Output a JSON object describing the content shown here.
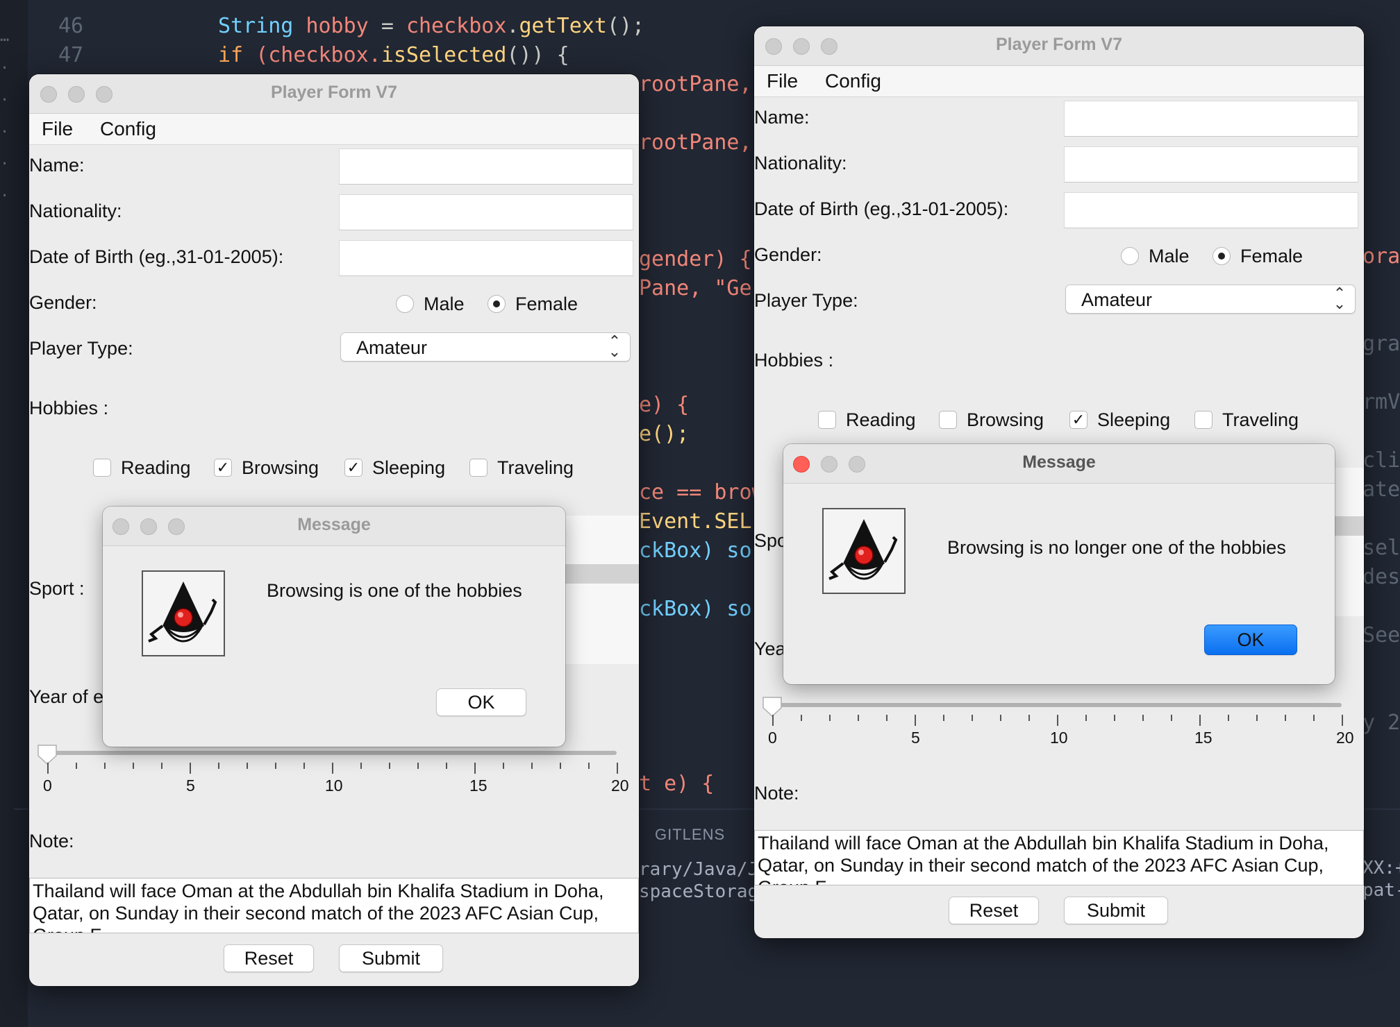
{
  "editor": {
    "line_numbers": [
      "46",
      "47"
    ],
    "code_line_46": [
      "String",
      "hobby",
      "=",
      "checkbox",
      ".",
      "getText",
      "();"
    ],
    "code_line_47": [
      "if",
      "(checkbox.",
      "isSelected",
      "()) {"
    ],
    "fragments": [
      "rootPane,",
      "rootPane,",
      "gender) {",
      "Pane, \"Ge",
      "e) {",
      "e();",
      "ce == brow",
      "Event.SEL",
      "ckBox) so",
      "ckBox) so",
      "t e) {",
      "rary/Java/J",
      "spaceStorag"
    ],
    "right_fragments": [
      "ora",
      "gra",
      "rmV",
      "cli",
      "ate",
      "sel",
      "des",
      "See",
      "y 2",
      "XX:+",
      "pat-"
    ],
    "panel_tab": "GITLENS"
  },
  "left_window": {
    "title": "Player Form V7",
    "menu": [
      "File",
      "Config"
    ],
    "labels": {
      "name": "Name:",
      "nationality": "Nationality:",
      "dob": "Date of Birth (eg.,31-01-2005):",
      "gender": "Gender:",
      "player_type": "Player Type:",
      "hobbies": "Hobbies :",
      "sport": "Sport :",
      "year": "Year of e",
      "note": "Note:"
    },
    "gender_options": [
      "Male",
      "Female"
    ],
    "gender_selected": "Female",
    "player_type_value": "Amateur",
    "hobbies": [
      {
        "label": "Reading",
        "checked": false
      },
      {
        "label": "Browsing",
        "checked": true
      },
      {
        "label": "Sleeping",
        "checked": true
      },
      {
        "label": "Traveling",
        "checked": false
      }
    ],
    "slider": {
      "min": 0,
      "max": 20,
      "value": 0,
      "labels": [
        "0",
        "5",
        "10",
        "15",
        "20"
      ]
    },
    "note_text_line1": "Thailand will face Oman at the Abdullah bin Khalifa Stadium in Doha,",
    "note_text_line2": "Qatar, on Sunday in their second match of the 2023 AFC Asian Cup,",
    "note_text_line3": "Group F.",
    "reset_label": "Reset",
    "submit_label": "Submit",
    "dialog": {
      "title": "Message",
      "message": "Browsing is one of the hobbies",
      "ok_label": "OK"
    }
  },
  "right_window": {
    "title": "Player Form V7",
    "menu": [
      "File",
      "Config"
    ],
    "labels": {
      "name": "Name:",
      "nationality": "Nationality:",
      "dob": "Date of Birth (eg.,31-01-2005):",
      "gender": "Gender:",
      "player_type": "Player Type:",
      "hobbies": "Hobbies :",
      "sport": "Spo",
      "year": "Yea",
      "note": "Note:"
    },
    "gender_options": [
      "Male",
      "Female"
    ],
    "gender_selected": "Female",
    "player_type_value": "Amateur",
    "hobbies": [
      {
        "label": "Reading",
        "checked": false
      },
      {
        "label": "Browsing",
        "checked": false
      },
      {
        "label": "Sleeping",
        "checked": true
      },
      {
        "label": "Traveling",
        "checked": false
      }
    ],
    "slider": {
      "min": 0,
      "max": 20,
      "value": 0,
      "labels": [
        "0",
        "5",
        "10",
        "15",
        "20"
      ]
    },
    "note_text_line1": "Thailand will face Oman at the Abdullah bin Khalifa Stadium in Doha,",
    "note_text_line2": "Qatar, on Sunday in their second match of the 2023 AFC Asian Cup,",
    "note_text_line3": "Group F.",
    "reset_label": "Reset",
    "submit_label": "Submit",
    "dialog": {
      "title": "Message",
      "message": "Browsing is no longer one of the hobbies",
      "ok_label": "OK"
    }
  },
  "colors": {
    "editor_bg": "#212733",
    "window_bg": "#ececec",
    "primary_button": "#0a6ff0",
    "close_button": "#ff5f57"
  }
}
